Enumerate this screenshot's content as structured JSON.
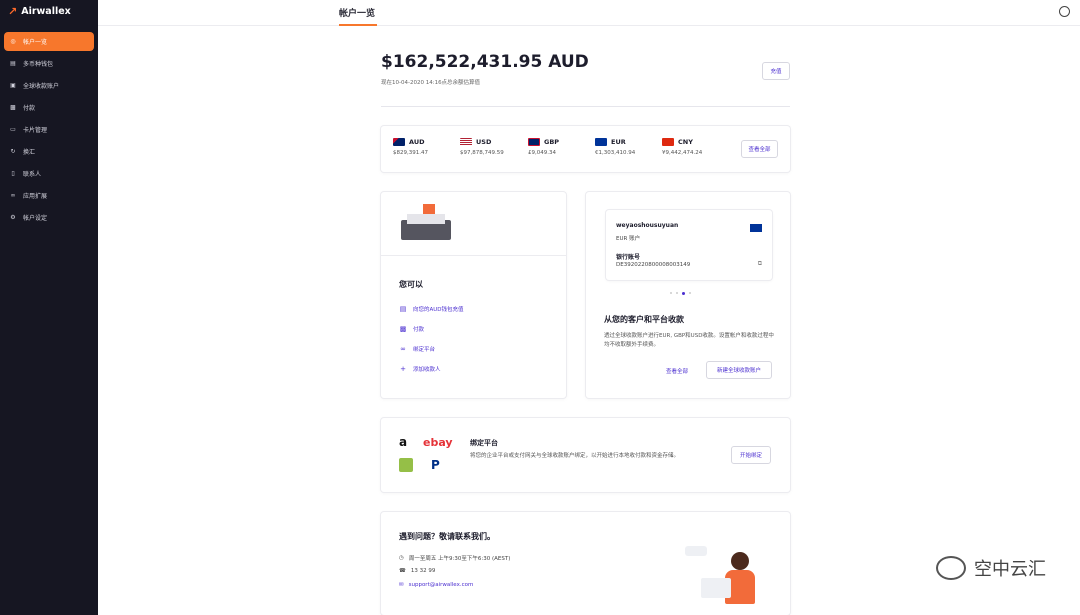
{
  "app": {
    "brand": "Airwallex"
  },
  "sidebar": {
    "items": [
      {
        "label": "帐户一览",
        "icon": "dashboard-icon",
        "active": true
      },
      {
        "label": "多币种钱包",
        "icon": "wallet-icon"
      },
      {
        "label": "全球收款账户",
        "icon": "bank-icon"
      },
      {
        "label": "付款",
        "icon": "payment-icon"
      },
      {
        "label": "卡片管理",
        "icon": "card-icon"
      },
      {
        "label": "换汇",
        "icon": "exchange-icon"
      },
      {
        "label": "联系人",
        "icon": "contacts-icon"
      },
      {
        "label": "应用扩展",
        "icon": "link-icon"
      },
      {
        "label": "帐户设定",
        "icon": "gear-icon"
      }
    ]
  },
  "header": {
    "tab": "帐户一览"
  },
  "balance": {
    "amount": "$162,522,431.95 AUD",
    "subtitle": "现在10-04-2020 14:16点总余额估算值",
    "topup_label": "充值"
  },
  "currencies": {
    "items": [
      {
        "code": "AUD",
        "amount": "$829,391.47"
      },
      {
        "code": "USD",
        "amount": "$97,878,749.59"
      },
      {
        "code": "GBP",
        "amount": "£9,049.34"
      },
      {
        "code": "EUR",
        "amount": "€1,303,410.94"
      },
      {
        "code": "CNY",
        "amount": "¥9,442,474.24"
      }
    ],
    "view_all_label": "查看全部"
  },
  "you_can": {
    "title": "您可以",
    "actions": [
      {
        "label": "向您的AUD钱包充值",
        "icon": "wallet-icon"
      },
      {
        "label": "付款",
        "icon": "payment-icon"
      },
      {
        "label": "绑定平台",
        "icon": "link-icon"
      },
      {
        "label": "添加收款人",
        "icon": "add-user-icon"
      }
    ]
  },
  "global_account": {
    "card": {
      "name": "weyaoshousuyuan",
      "type": "EUR 账户",
      "bank_no_label": "银行账号",
      "bank_no": "DE3920220800008003149"
    },
    "title": "从您的客户和平台收款",
    "desc": "透过全球收款账户进行EUR, GBP和USD收款。设置帐户和收款过程中均不收取额外手续费。",
    "view_all_label": "查看全部",
    "new_account_label": "新建全球收款账户"
  },
  "platform": {
    "title": "绑定平台",
    "desc": "将您的企业平台或支付网关与全球收款账户绑定，以开始进行本地收付款和资金存储。",
    "button_label": "开始绑定",
    "logos": [
      "amazon",
      "ebay",
      "shopify",
      "paypal"
    ]
  },
  "support": {
    "title": "遇到问题？敬请联系我们。",
    "hours": "周一至周五 上午9:30至下午6:30 (AEST)",
    "phone": "13 32 99",
    "email": "support@airwallex.com"
  },
  "watermark": {
    "text": "空中云汇"
  }
}
